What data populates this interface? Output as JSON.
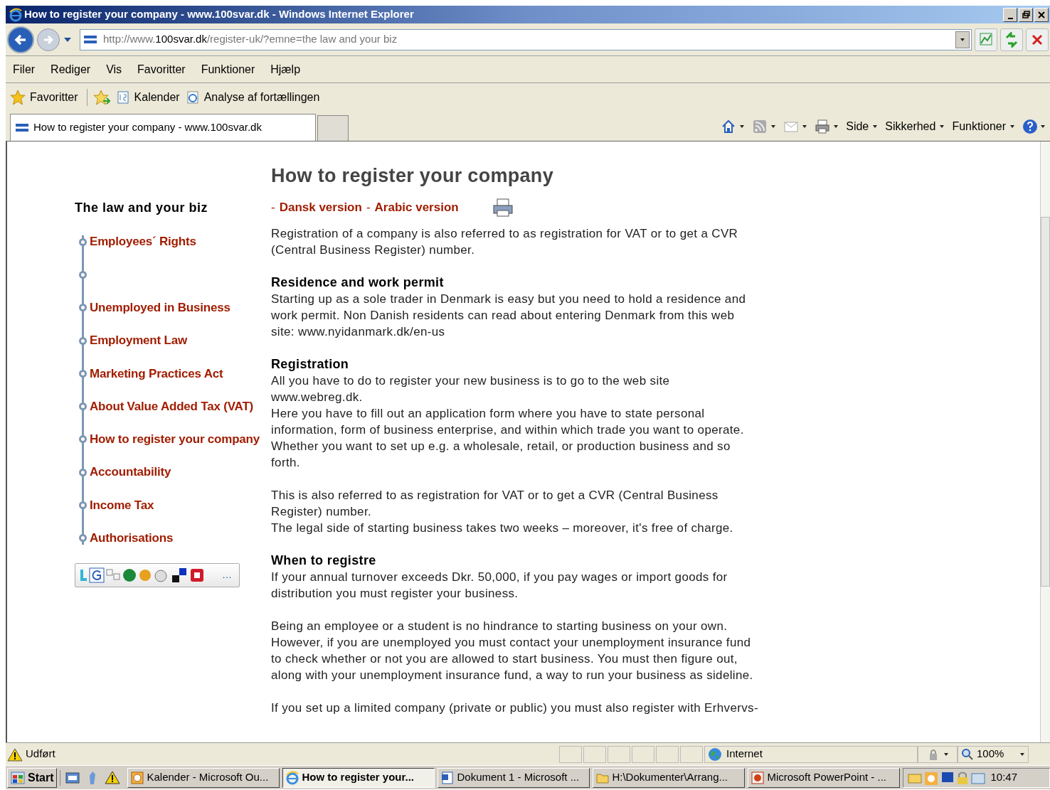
{
  "window": {
    "title": "How to register your company - www.100svar.dk - Windows Internet Explorer"
  },
  "address_bar": {
    "url_prefix": "http://www.",
    "url_host": "100svar.dk",
    "url_path": "/register-uk/?emne=the law and your biz"
  },
  "menu_bar": [
    "Filer",
    "Rediger",
    "Vis",
    "Favoritter",
    "Funktioner",
    "Hjælp"
  ],
  "favorites_bar": {
    "favorites": "Favoritter",
    "links": [
      {
        "label": "Kalender",
        "kind": "calendar"
      },
      {
        "label": "Analyse af fortællingen",
        "kind": "page"
      }
    ]
  },
  "tab": {
    "title": "How to register your company - www.100svar.dk",
    "selected": true
  },
  "command_bar": [
    "Side",
    "Sikkerhed",
    "Funktioner"
  ],
  "page": {
    "title": "How to register your company",
    "sidebar": {
      "heading": "The law and your biz",
      "items": [
        {
          "kind": "link",
          "label": "Employees´ Rights"
        },
        {
          "kind": "blank"
        },
        {
          "kind": "link",
          "label": "Unemployed in Business"
        },
        {
          "kind": "link",
          "label": "Employment Law"
        },
        {
          "kind": "link",
          "label": "Marketing Practices Act"
        },
        {
          "kind": "link",
          "label": "About Value Added Tax (VAT)"
        },
        {
          "kind": "link",
          "label": "How to register your company"
        },
        {
          "kind": "link",
          "label": "Accountability"
        },
        {
          "kind": "link",
          "label": "Income Tax"
        },
        {
          "kind": "link",
          "label": "Authorisations"
        }
      ],
      "share_more": "…"
    },
    "version_links": [
      {
        "dash": "-",
        "label": "Dansk version"
      },
      {
        "dash": "-",
        "label": "Arabic version"
      }
    ],
    "blocks": [
      {
        "lines": [
          "Registration of a company is also referred to as registration for VAT or to get a CVR",
          "(Central Business Register) number."
        ]
      },
      {
        "heading": "Residence and work permit",
        "lines": [
          "Starting up as a sole trader in Denmark is easy but you need to hold a residence and",
          "work permit. Non Danish residents can read about entering Denmark from this web",
          "site: www.nyidanmark.dk/en-us"
        ]
      },
      {
        "heading": "Registration",
        "lines": [
          "All you have to do to register your new business is to go to the web site",
          "www.webreg.dk.",
          "Here you have to fill out an application form where you have to state personal",
          "information, form of business enterprise, and within which trade you want to operate.",
          "Whether you want to set up e.g. a wholesale, retail, or production business and so",
          "forth."
        ]
      },
      {
        "lines": [
          "This is also referred to as registration for VAT or to get a CVR (Central Business",
          "Register) number.",
          "The legal side of starting business takes two weeks – moreover, it's free of charge."
        ]
      },
      {
        "heading": "When to registre",
        "lines": [
          "If your annual turnover exceeds Dkr. 50,000, if you pay wages or import goods for",
          "distribution you must register your business."
        ]
      },
      {
        "lines": [
          "Being an employee or a student is no hindrance to starting business on your own.",
          "However, if you are unemployed you must contact your unemployment insurance fund",
          "to check whether or not you are allowed to start business. You must then figure out,",
          "along with your unemployment insurance fund, a way to run your business as sideline."
        ]
      },
      {
        "lines": [
          "If you set up a limited company (private or public) you must also register with Erhvervs-"
        ]
      }
    ]
  },
  "status_bar": {
    "status": "Udført",
    "zone": "Internet",
    "zoom": "100%"
  },
  "taskbar": {
    "start": "Start",
    "tasks": [
      {
        "label": "Kalender - Microsoft Ou...",
        "kind": "outlook",
        "selected": false
      },
      {
        "label": "How to register your...",
        "kind": "ie",
        "selected": true
      },
      {
        "label": "Dokument 1 - Microsoft ...",
        "kind": "word",
        "selected": false
      },
      {
        "label": "H:\\Dokumenter\\Arrang...",
        "kind": "folder",
        "selected": false
      },
      {
        "label": "Microsoft PowerPoint - ...",
        "kind": "powerpoint",
        "selected": false
      }
    ],
    "clock": "10:47"
  }
}
